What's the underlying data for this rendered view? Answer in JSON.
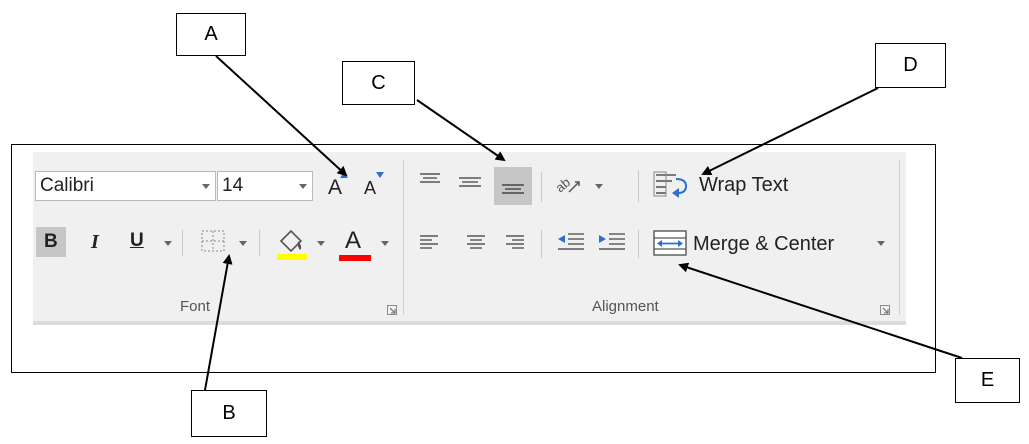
{
  "font_group": {
    "font_name": "Calibri",
    "font_size": "14",
    "increase_font_label": "A",
    "decrease_font_label": "A",
    "bold_label": "B",
    "italic_label": "I",
    "underline_label": "U",
    "font_color_label": "A",
    "group_label": "Font",
    "highlight_color": "#ffff00",
    "font_color": "#ff0000"
  },
  "alignment_group": {
    "wrap_text_label": "Wrap Text",
    "merge_center_label": "Merge & Center",
    "group_label": "Alignment"
  },
  "callouts": {
    "a": "A",
    "b": "B",
    "c": "C",
    "d": "D",
    "e": "E"
  }
}
